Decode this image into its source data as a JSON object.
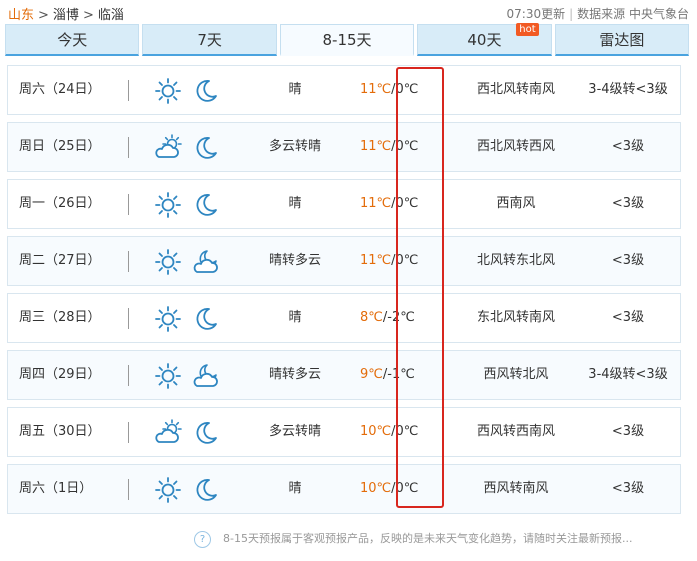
{
  "breadcrumb": {
    "province": "山东",
    "city": "淄博",
    "district": "临淄",
    "separator": ">"
  },
  "header": {
    "update_time": "07:30更新",
    "divider": "|",
    "source": "数据来源 中央气象台"
  },
  "tabs": [
    {
      "label": "今天",
      "active": false,
      "badge": ""
    },
    {
      "label": "7天",
      "active": false,
      "badge": ""
    },
    {
      "label": "8-15天",
      "active": true,
      "badge": ""
    },
    {
      "label": "40天",
      "active": false,
      "badge": "hot"
    },
    {
      "label": "雷达图",
      "active": false,
      "badge": ""
    }
  ],
  "forecast": [
    {
      "day": "周六（24日）",
      "icon_day": "sun-icon",
      "icon_night": "moon-icon",
      "weather": "晴",
      "high": "11℃",
      "low": "/0℃",
      "wind": "西北风转南风",
      "level": "3-4级转<3级"
    },
    {
      "day": "周日（25日）",
      "icon_day": "partly-cloudy-icon",
      "icon_night": "moon-icon",
      "weather": "多云转晴",
      "high": "11℃",
      "low": "/0℃",
      "wind": "西北风转西风",
      "level": "<3级"
    },
    {
      "day": "周一（26日）",
      "icon_day": "sun-icon",
      "icon_night": "moon-icon",
      "weather": "晴",
      "high": "11℃",
      "low": "/0℃",
      "wind": "西南风",
      "level": "<3级"
    },
    {
      "day": "周二（27日）",
      "icon_day": "sun-icon",
      "icon_night": "cloudy-night-icon",
      "weather": "晴转多云",
      "high": "11℃",
      "low": "/0℃",
      "wind": "北风转东北风",
      "level": "<3级"
    },
    {
      "day": "周三（28日）",
      "icon_day": "sun-icon",
      "icon_night": "moon-icon",
      "weather": "晴",
      "high": "8℃",
      "low": "/-2℃",
      "wind": "东北风转南风",
      "level": "<3级"
    },
    {
      "day": "周四（29日）",
      "icon_day": "sun-icon",
      "icon_night": "cloudy-night-icon",
      "weather": "晴转多云",
      "high": "9℃",
      "low": "/-1℃",
      "wind": "西风转北风",
      "level": "3-4级转<3级"
    },
    {
      "day": "周五（30日）",
      "icon_day": "partly-cloudy-icon",
      "icon_night": "moon-icon",
      "weather": "多云转晴",
      "high": "10℃",
      "low": "/0℃",
      "wind": "西风转西南风",
      "level": "<3级"
    },
    {
      "day": "周六（1日）",
      "icon_day": "sun-icon",
      "icon_night": "moon-icon",
      "weather": "晴",
      "high": "10℃",
      "low": "/0℃",
      "wind": "西风转南风",
      "level": "<3级"
    }
  ],
  "footnote": {
    "icon": "question-icon",
    "mark": "?",
    "text": "8-15天预报属于客观预报产品，反映的是未来天气变化趋势，请随时关注最新预报..."
  },
  "colors": {
    "accent_orange": "#e36c0a",
    "tab_blue": "#d8ecf8",
    "icon_blue": "#2e86c1",
    "highlight_red": "#d8261e"
  }
}
